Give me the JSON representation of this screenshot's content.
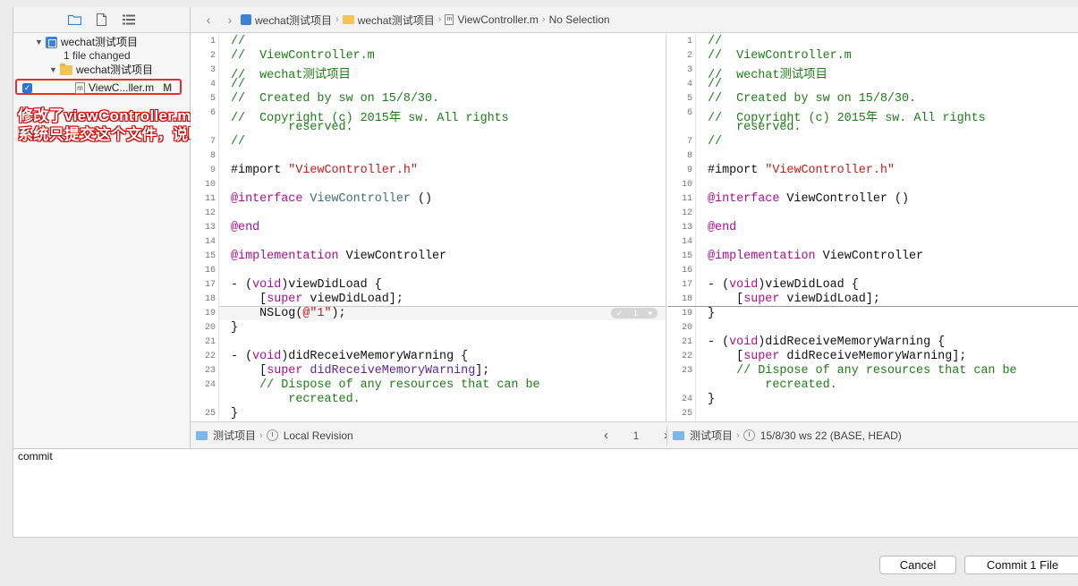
{
  "sidebar": {
    "project_name": "wechat测试项目",
    "files_changed": "1 file changed",
    "group_name": "wechat测试项目",
    "file_name": "ViewC...ller.m",
    "file_status": "M"
  },
  "annotation": {
    "line1": "修改了viewController.m文件",
    "line2": "系统只提交这个文件，说明忽略成功"
  },
  "jumpbar": {
    "crumbs": [
      "wechat测试项目",
      "wechat测试项目",
      "ViewController.m",
      "No Selection"
    ]
  },
  "left_code": [
    {
      "n": "1",
      "t": [
        [
          "cmt",
          "//"
        ]
      ]
    },
    {
      "n": "2",
      "t": [
        [
          "cmt",
          "//  ViewController.m"
        ]
      ]
    },
    {
      "n": "3",
      "t": [
        [
          "cmt",
          "//  wechat测试项目"
        ]
      ]
    },
    {
      "n": "4",
      "t": [
        [
          "cmt",
          "//"
        ]
      ]
    },
    {
      "n": "5",
      "t": [
        [
          "cmt",
          "//  Created by sw on 15/8/30."
        ]
      ]
    },
    {
      "n": "6",
      "t": [
        [
          "cmt",
          "//  Copyright (c) 2015年 sw. All rights"
        ]
      ]
    },
    {
      "n": "",
      "t": [
        [
          "cmt",
          "        reserved."
        ]
      ]
    },
    {
      "n": "7",
      "t": [
        [
          "cmt",
          "//"
        ]
      ]
    },
    {
      "n": "8",
      "t": []
    },
    {
      "n": "9",
      "t": [
        [
          "",
          "#import "
        ],
        [
          "str",
          "\"ViewController.h\""
        ]
      ]
    },
    {
      "n": "10",
      "t": []
    },
    {
      "n": "11",
      "t": [
        [
          "kw",
          "@interface"
        ],
        [
          "",
          " "
        ],
        [
          "cls",
          "ViewController"
        ],
        [
          "",
          " ()"
        ]
      ]
    },
    {
      "n": "12",
      "t": []
    },
    {
      "n": "13",
      "t": [
        [
          "kw",
          "@end"
        ]
      ]
    },
    {
      "n": "14",
      "t": []
    },
    {
      "n": "15",
      "t": [
        [
          "kw",
          "@implementation"
        ],
        [
          "",
          " ViewController"
        ]
      ]
    },
    {
      "n": "16",
      "t": []
    },
    {
      "n": "17",
      "t": [
        [
          "",
          "- ("
        ],
        [
          "kw",
          "void"
        ],
        [
          "",
          ")viewDidLoad {"
        ]
      ]
    },
    {
      "n": "18",
      "t": [
        [
          "",
          "    ["
        ],
        [
          "kw",
          "super"
        ],
        [
          "",
          " viewDidLoad];"
        ]
      ]
    },
    {
      "n": "19",
      "t": [
        [
          "",
          "    NSLog("
        ],
        [
          "str",
          "@\"1\""
        ],
        [
          "",
          ");"
        ]
      ]
    },
    {
      "n": "20",
      "t": [
        [
          "",
          "}"
        ]
      ]
    },
    {
      "n": "21",
      "t": []
    },
    {
      "n": "22",
      "t": [
        [
          "",
          "- ("
        ],
        [
          "kw",
          "void"
        ],
        [
          "",
          ")didReceiveMemoryWarning {"
        ]
      ]
    },
    {
      "n": "23",
      "t": [
        [
          "",
          "    ["
        ],
        [
          "kw",
          "super"
        ],
        [
          "",
          " "
        ],
        [
          "typ",
          "didReceiveMemoryWarning"
        ],
        [
          "",
          "];"
        ]
      ]
    },
    {
      "n": "24",
      "t": [
        [
          "cmt",
          "    // Dispose of any resources that can be"
        ]
      ]
    },
    {
      "n": "",
      "t": [
        [
          "cmt",
          "        recreated."
        ]
      ]
    },
    {
      "n": "25",
      "t": [
        [
          "",
          "}"
        ]
      ]
    }
  ],
  "right_code": [
    {
      "n": "1",
      "t": [
        [
          "cmt",
          "//"
        ]
      ]
    },
    {
      "n": "2",
      "t": [
        [
          "cmt",
          "//  ViewController.m"
        ]
      ]
    },
    {
      "n": "3",
      "t": [
        [
          "cmt",
          "//  wechat测试项目"
        ]
      ]
    },
    {
      "n": "4",
      "t": [
        [
          "cmt",
          "//"
        ]
      ]
    },
    {
      "n": "5",
      "t": [
        [
          "cmt",
          "//  Created by sw on 15/8/30."
        ]
      ]
    },
    {
      "n": "6",
      "t": [
        [
          "cmt",
          "//  Copyright (c) 2015年 sw. All rights"
        ]
      ]
    },
    {
      "n": "",
      "t": [
        [
          "cmt",
          "    reserved."
        ]
      ]
    },
    {
      "n": "7",
      "t": [
        [
          "cmt",
          "//"
        ]
      ]
    },
    {
      "n": "8",
      "t": []
    },
    {
      "n": "9",
      "t": [
        [
          "",
          "#import "
        ],
        [
          "str",
          "\"ViewController.h\""
        ]
      ]
    },
    {
      "n": "10",
      "t": []
    },
    {
      "n": "11",
      "t": [
        [
          "kw",
          "@interface"
        ],
        [
          "",
          " ViewController ()"
        ]
      ]
    },
    {
      "n": "12",
      "t": []
    },
    {
      "n": "13",
      "t": [
        [
          "kw",
          "@end"
        ]
      ]
    },
    {
      "n": "14",
      "t": []
    },
    {
      "n": "15",
      "t": [
        [
          "kw",
          "@implementation"
        ],
        [
          "",
          " ViewController"
        ]
      ]
    },
    {
      "n": "16",
      "t": []
    },
    {
      "n": "17",
      "t": [
        [
          "",
          "- ("
        ],
        [
          "kw",
          "void"
        ],
        [
          "",
          ")viewDidLoad {"
        ]
      ]
    },
    {
      "n": "18",
      "t": [
        [
          "",
          "    ["
        ],
        [
          "kw",
          "super"
        ],
        [
          "",
          " viewDidLoad];"
        ]
      ]
    },
    {
      "n": "19",
      "t": [
        [
          "",
          "}"
        ]
      ]
    },
    {
      "n": "20",
      "t": []
    },
    {
      "n": "21",
      "t": [
        [
          "",
          "- ("
        ],
        [
          "kw",
          "void"
        ],
        [
          "",
          ")didReceiveMemoryWarning {"
        ]
      ]
    },
    {
      "n": "22",
      "t": [
        [
          "",
          "    ["
        ],
        [
          "kw",
          "super"
        ],
        [
          "",
          " didReceiveMemoryWarning];"
        ]
      ]
    },
    {
      "n": "23",
      "t": [
        [
          "cmt",
          "    // Dispose of any resources that can be"
        ]
      ]
    },
    {
      "n": "",
      "t": [
        [
          "cmt",
          "        recreated."
        ]
      ]
    },
    {
      "n": "24",
      "t": [
        [
          "",
          "}"
        ]
      ]
    },
    {
      "n": "25",
      "t": []
    }
  ],
  "change_marker": {
    "count": "1"
  },
  "bottom_bar": {
    "left_folder": "测试项目",
    "left_revision": "Local Revision",
    "page": "1",
    "right_folder": "测试项目",
    "right_revision": "15/8/30  ws  22 (BASE, HEAD)"
  },
  "commit": {
    "message": "commit"
  },
  "buttons": {
    "cancel": "Cancel",
    "commit": "Commit 1 File"
  }
}
